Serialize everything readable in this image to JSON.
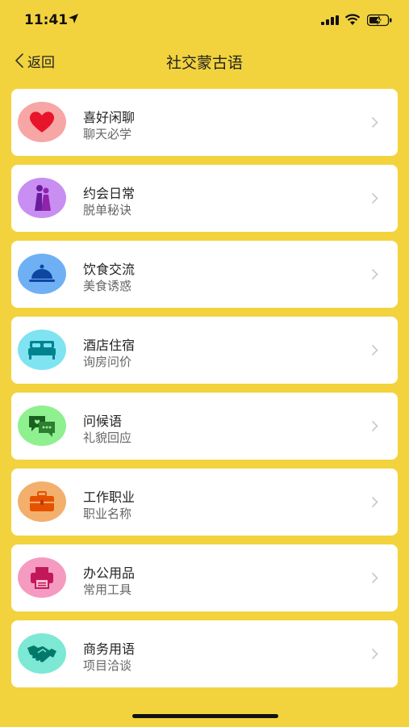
{
  "status": {
    "time": "11:41",
    "icons": [
      "location-arrow-icon",
      "signal-icon",
      "wifi-icon",
      "battery-charging-icon"
    ]
  },
  "nav": {
    "back_label": "返回",
    "title": "社交蒙古语"
  },
  "categories": [
    {
      "title": "喜好闲聊",
      "subtitle": "聊天必学",
      "icon": "heart-icon",
      "color": "#f7a6a6"
    },
    {
      "title": "约会日常",
      "subtitle": "脱单秘诀",
      "icon": "couple-icon",
      "color": "#c98ef2"
    },
    {
      "title": "饮食交流",
      "subtitle": "美食诱惑",
      "icon": "food-cloche-icon",
      "color": "#6fb0f5"
    },
    {
      "title": "酒店住宿",
      "subtitle": "询房问价",
      "icon": "bed-icon",
      "color": "#7fe3f2"
    },
    {
      "title": "问候语",
      "subtitle": "礼貌回应",
      "icon": "chat-bubbles-icon",
      "color": "#8ef08e"
    },
    {
      "title": "工作职业",
      "subtitle": "职业名称",
      "icon": "briefcase-icon",
      "color": "#f2b06c"
    },
    {
      "title": "办公用品",
      "subtitle": "常用工具",
      "icon": "printer-icon",
      "color": "#f59ac0"
    },
    {
      "title": "商务用语",
      "subtitle": "项目洽谈",
      "icon": "handshake-icon",
      "color": "#7de8d3"
    }
  ],
  "colors": {
    "background": "#f2d33e",
    "card": "#ffffff",
    "chevron": "#c8c8c8"
  }
}
